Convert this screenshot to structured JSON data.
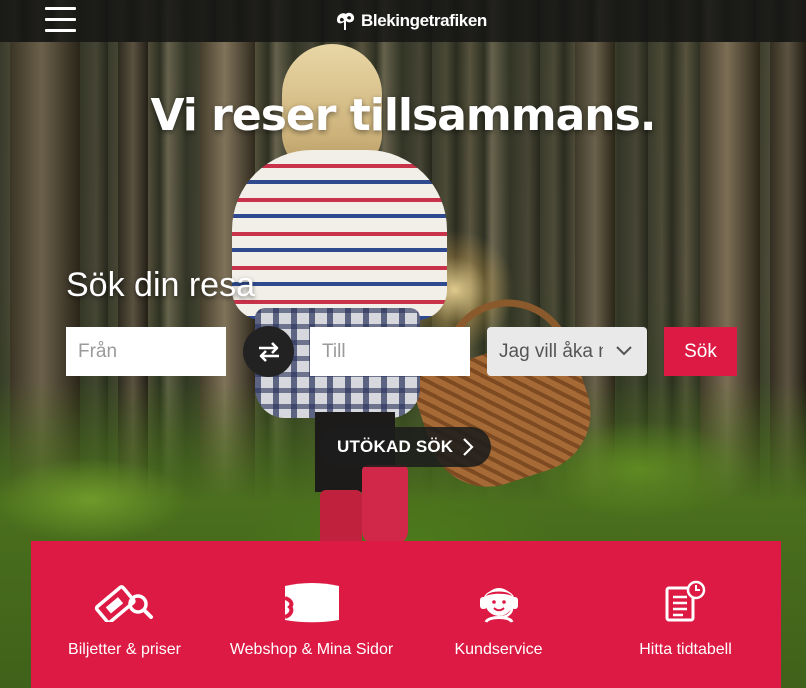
{
  "header": {
    "logo_text": "Blekingetrafiken",
    "menu_icon": "hamburger-menu-icon"
  },
  "hero": {
    "headline": "Vi reser tillsammans."
  },
  "search": {
    "title": "Sök din resa",
    "from_placeholder": "Från",
    "to_placeholder": "Till",
    "swap_icon": "swap-arrows-icon",
    "when_select_value": "Jag vill åka nu",
    "submit_label": "Sök",
    "advanced_label": "UTÖKAD SÖK"
  },
  "quick_links": [
    {
      "label": "Biljetter & priser",
      "icon": "ticket-search-icon"
    },
    {
      "label": "Webshop & Mina Sidor",
      "icon": "card-icon"
    },
    {
      "label": "Kundservice",
      "icon": "headset-person-icon"
    },
    {
      "label": "Hitta tidtabell",
      "icon": "timetable-clock-icon"
    }
  ],
  "colors": {
    "brand_red": "#dc1a44",
    "topbar": "#141414",
    "swap_button": "#222222"
  }
}
